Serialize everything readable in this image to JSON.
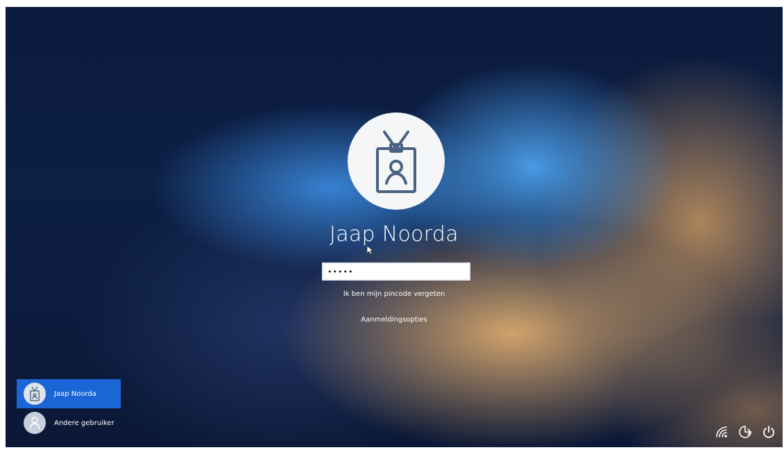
{
  "lock_screen": {
    "user_name": "Jaap Noorda",
    "pin_field": {
      "value": "•••••",
      "placeholder": ""
    },
    "forgot_pin_link": "Ik ben mijn pincode vergeten",
    "sign_in_options_link": "Aanmeldingsopties",
    "avatar_icon": "id-badge-icon"
  },
  "user_switcher": {
    "users": [
      {
        "label": "Jaap Noorda",
        "icon": "id-badge-icon",
        "selected": true
      },
      {
        "label": "Andere gebruiker",
        "icon": "person-icon",
        "selected": false
      }
    ]
  },
  "system_tray": {
    "icons": [
      "network-icon",
      "accessibility-icon",
      "power-icon"
    ]
  },
  "colors": {
    "selected_user": "#1a66d6",
    "text": "#ffffff",
    "badge_stroke": "#4a6282"
  }
}
